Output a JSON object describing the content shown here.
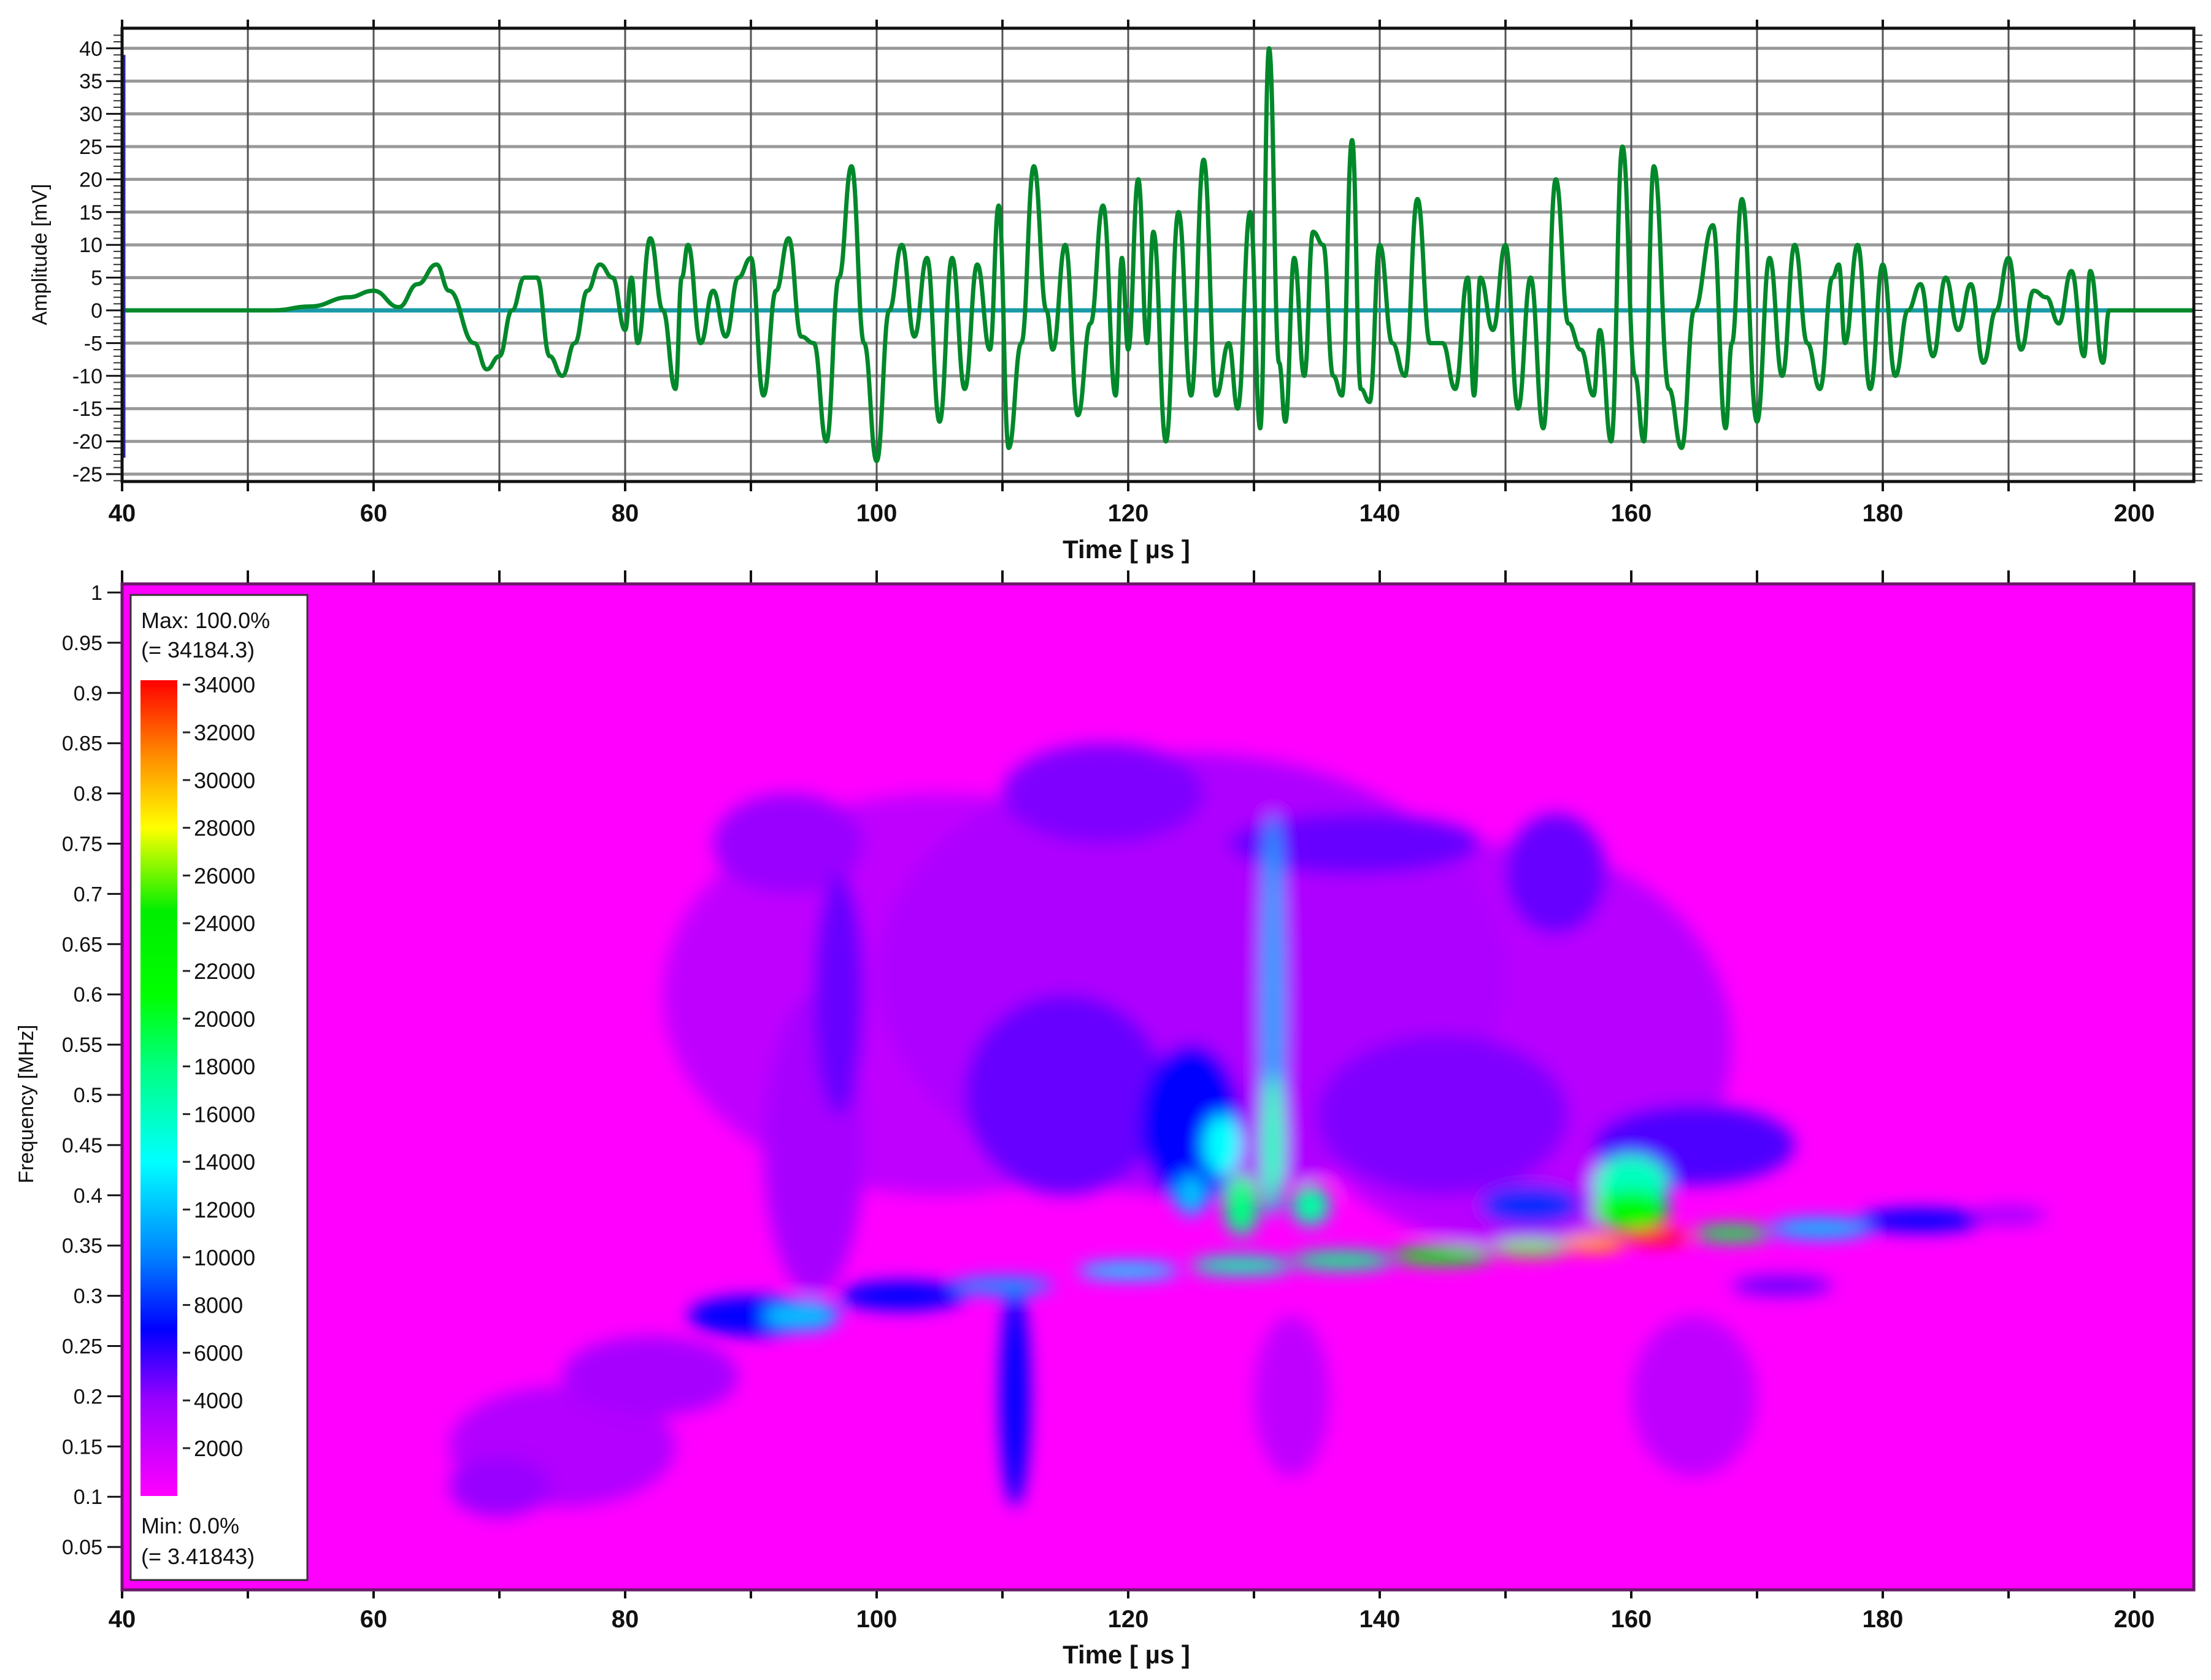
{
  "chart_data": [
    {
      "type": "line",
      "title": "",
      "xlabel": "Time  [ µs ]",
      "ylabel": "Amplitude [mV]",
      "xlim": [
        40,
        205
      ],
      "ylim": [
        -26.5,
        43
      ],
      "x_ticks": [
        "40",
        "60",
        "80",
        "100",
        "120",
        "140",
        "160",
        "180",
        "200"
      ],
      "y_ticks": [
        "40",
        "35",
        "30",
        "25",
        "20",
        "15",
        "10",
        "5",
        "0",
        "-5",
        "-10",
        "-15",
        "-20",
        "-25"
      ],
      "grid": true,
      "colors": {
        "signal": "#00882a",
        "baseline": "#1a9aa8",
        "marker": "#2a2a9a"
      },
      "marker_line": {
        "t": 40,
        "from": -22.5,
        "to": 39
      },
      "series": [
        {
          "name": "signal",
          "extrema": [
            [
              40,
              0
            ],
            [
              52,
              0
            ],
            [
              55,
              0.6
            ],
            [
              58,
              2
            ],
            [
              60,
              3
            ],
            [
              62,
              0.5
            ],
            [
              63.5,
              4
            ],
            [
              65,
              7
            ],
            [
              66,
              3
            ],
            [
              68,
              -5
            ],
            [
              69,
              -9
            ],
            [
              70,
              -7
            ],
            [
              71,
              0
            ],
            [
              72,
              5
            ],
            [
              73,
              5
            ],
            [
              74,
              -7
            ],
            [
              75,
              -10
            ],
            [
              76,
              -5
            ],
            [
              77,
              3
            ],
            [
              78,
              7
            ],
            [
              79,
              5
            ],
            [
              80,
              -3
            ],
            [
              80.5,
              5
            ],
            [
              81,
              -5
            ],
            [
              82,
              11
            ],
            [
              83,
              0
            ],
            [
              84,
              -12
            ],
            [
              84.5,
              5
            ],
            [
              85,
              10
            ],
            [
              86,
              -5
            ],
            [
              87,
              3
            ],
            [
              88,
              -4
            ],
            [
              89,
              5
            ],
            [
              90,
              8
            ],
            [
              91,
              -13
            ],
            [
              92,
              3
            ],
            [
              93,
              11
            ],
            [
              94,
              -4
            ],
            [
              95,
              -5
            ],
            [
              96,
              -20
            ],
            [
              97,
              5
            ],
            [
              98,
              22
            ],
            [
              99,
              -5
            ],
            [
              100,
              -23
            ],
            [
              101,
              0
            ],
            [
              102,
              10
            ],
            [
              103,
              -4
            ],
            [
              104,
              8
            ],
            [
              105,
              -17
            ],
            [
              106,
              8
            ],
            [
              107,
              -12
            ],
            [
              108,
              7
            ],
            [
              109,
              -6
            ],
            [
              109.7,
              16
            ],
            [
              110.5,
              -21
            ],
            [
              111.5,
              -5
            ],
            [
              112.5,
              22
            ],
            [
              113.5,
              0
            ],
            [
              114,
              -6
            ],
            [
              115,
              10
            ],
            [
              116,
              -16
            ],
            [
              117,
              -2
            ],
            [
              118,
              16
            ],
            [
              119,
              -13
            ],
            [
              119.5,
              8
            ],
            [
              120,
              -6
            ],
            [
              120.8,
              20
            ],
            [
              121.5,
              -5
            ],
            [
              122,
              12
            ],
            [
              123,
              -20
            ],
            [
              124,
              15
            ],
            [
              125,
              -13
            ],
            [
              126,
              23
            ],
            [
              127,
              -13
            ],
            [
              128,
              -5
            ],
            [
              128.7,
              -15
            ],
            [
              129.7,
              15
            ],
            [
              130.5,
              -18
            ],
            [
              131.2,
              40
            ],
            [
              132,
              -8
            ],
            [
              132.5,
              -17
            ],
            [
              133.2,
              8
            ],
            [
              134,
              -10
            ],
            [
              134.7,
              12
            ],
            [
              135.5,
              10
            ],
            [
              136.3,
              -10
            ],
            [
              137,
              -13
            ],
            [
              137.8,
              26
            ],
            [
              138.5,
              -12
            ],
            [
              139.2,
              -14
            ],
            [
              140,
              10
            ],
            [
              141,
              -5
            ],
            [
              142,
              -10
            ],
            [
              143,
              17
            ],
            [
              144,
              -5
            ],
            [
              145,
              -5
            ],
            [
              146,
              -12
            ],
            [
              147,
              5
            ],
            [
              147.5,
              -13
            ],
            [
              148,
              5
            ],
            [
              149,
              -3
            ],
            [
              150,
              10
            ],
            [
              151,
              -15
            ],
            [
              152,
              5
            ],
            [
              153,
              -18
            ],
            [
              154,
              20
            ],
            [
              155,
              -2
            ],
            [
              156,
              -6
            ],
            [
              157,
              -13
            ],
            [
              157.5,
              -3
            ],
            [
              158.4,
              -20
            ],
            [
              159.3,
              25
            ],
            [
              160.3,
              -10
            ],
            [
              161,
              -20
            ],
            [
              161.8,
              22
            ],
            [
              163,
              -12
            ],
            [
              164,
              -21
            ],
            [
              165,
              0
            ],
            [
              166.5,
              13
            ],
            [
              167.5,
              -18
            ],
            [
              168,
              -5
            ],
            [
              168.8,
              17
            ],
            [
              170,
              -17
            ],
            [
              171,
              8
            ],
            [
              172,
              -10
            ],
            [
              173,
              10
            ],
            [
              174,
              -5
            ],
            [
              175,
              -12
            ],
            [
              176,
              5
            ],
            [
              176.5,
              7
            ],
            [
              177,
              -5
            ],
            [
              178,
              10
            ],
            [
              179,
              -12
            ],
            [
              180,
              7
            ],
            [
              181,
              -10
            ],
            [
              182,
              0
            ],
            [
              183,
              4
            ],
            [
              184,
              -7
            ],
            [
              185,
              5
            ],
            [
              186,
              -3
            ],
            [
              187,
              4
            ],
            [
              188,
              -8
            ],
            [
              189,
              0
            ],
            [
              190,
              8
            ],
            [
              191,
              -6
            ],
            [
              192,
              3
            ],
            [
              193,
              2
            ],
            [
              194,
              -2
            ],
            [
              195,
              6
            ],
            [
              196,
              -7
            ],
            [
              196.5,
              6
            ],
            [
              197.5,
              -8
            ],
            [
              198,
              0
            ],
            [
              205,
              0
            ]
          ]
        }
      ]
    },
    {
      "type": "heatmap",
      "title": "",
      "xlabel": "Time  [ µs ]",
      "ylabel": "Frequency [MHz]",
      "xlim": [
        40,
        205
      ],
      "ylim": [
        0.007,
        1.01
      ],
      "x_ticks": [
        "40",
        "60",
        "80",
        "100",
        "120",
        "140",
        "160",
        "180",
        "200"
      ],
      "y_ticks": [
        "1",
        "0.95",
        "0.9",
        "0.85",
        "0.8",
        "0.75",
        "0.7",
        "0.65",
        "0.6",
        "0.55",
        "0.5",
        "0.45",
        "0.4",
        "0.35",
        "0.3",
        "0.25",
        "0.2",
        "0.15",
        "0.1",
        "0.05"
      ],
      "colorbar": {
        "max_label": "Max: 100.0%",
        "max_value_label": "(= 34184.3)",
        "min_label": "Min: 0.0%",
        "min_value_label": "(= 3.41843)",
        "ticks": [
          "34000",
          "32000",
          "30000",
          "28000",
          "26000",
          "24000",
          "22000",
          "20000",
          "18000",
          "16000",
          "14000",
          "12000",
          "10000",
          "8000",
          "6000",
          "4000",
          "2000"
        ],
        "range": [
          3.41843,
          34184.3
        ],
        "stops": [
          [
            0,
            "#ff00ff"
          ],
          [
            4000,
            "#9a00ff"
          ],
          [
            7000,
            "#0000ff"
          ],
          [
            10000,
            "#0080ff"
          ],
          [
            14000,
            "#00ffff"
          ],
          [
            18000,
            "#00ff80"
          ],
          [
            21000,
            "#00ff00"
          ],
          [
            24500,
            "#00ee00"
          ],
          [
            28000,
            "#ffff00"
          ],
          [
            31000,
            "#ff8c00"
          ],
          [
            34184,
            "#ff0000"
          ]
        ]
      },
      "hotspots": [
        {
          "t": 75,
          "f": 0.15,
          "dt": 9,
          "df": 0.06,
          "value": 3000
        },
        {
          "t": 70,
          "f": 0.11,
          "dt": 4,
          "df": 0.03,
          "value": 4000
        },
        {
          "t": 82,
          "f": 0.22,
          "dt": 7,
          "df": 0.04,
          "value": 3500
        },
        {
          "t": 105,
          "f": 0.6,
          "dt": 22,
          "df": 0.2,
          "value": 2500
        },
        {
          "t": 125,
          "f": 0.62,
          "dt": 25,
          "df": 0.22,
          "value": 3200
        },
        {
          "t": 150,
          "f": 0.55,
          "dt": 18,
          "df": 0.2,
          "value": 2800
        },
        {
          "t": 95,
          "f": 0.45,
          "dt": 4,
          "df": 0.15,
          "value": 3500
        },
        {
          "t": 97,
          "f": 0.6,
          "dt": 2,
          "df": 0.12,
          "value": 5000
        },
        {
          "t": 93,
          "f": 0.75,
          "dt": 6,
          "df": 0.05,
          "value": 4000
        },
        {
          "t": 118,
          "f": 0.8,
          "dt": 8,
          "df": 0.05,
          "value": 4500
        },
        {
          "t": 138,
          "f": 0.75,
          "dt": 10,
          "df": 0.03,
          "value": 5000
        },
        {
          "t": 154,
          "f": 0.72,
          "dt": 4,
          "df": 0.06,
          "value": 5000
        },
        {
          "t": 115,
          "f": 0.5,
          "dt": 8,
          "df": 0.1,
          "value": 5000
        },
        {
          "t": 125,
          "f": 0.47,
          "dt": 4,
          "df": 0.08,
          "value": 7000
        },
        {
          "t": 145,
          "f": 0.48,
          "dt": 10,
          "df": 0.08,
          "value": 4500
        },
        {
          "t": 165,
          "f": 0.45,
          "dt": 8,
          "df": 0.04,
          "value": 5500
        },
        {
          "t": 111,
          "f": 0.2,
          "dt": 1.2,
          "df": 0.11,
          "value": 7000
        },
        {
          "t": 131.5,
          "f": 0.58,
          "dt": 0.9,
          "df": 0.2,
          "value": 11000
        },
        {
          "t": 131.5,
          "f": 0.72,
          "dt": 0.8,
          "df": 0.06,
          "value": 7000
        },
        {
          "t": 131.5,
          "f": 0.45,
          "dt": 0.9,
          "df": 0.07,
          "value": 16000
        },
        {
          "t": 127.5,
          "f": 0.45,
          "dt": 1.5,
          "df": 0.03,
          "value": 14000
        },
        {
          "t": 129,
          "f": 0.39,
          "dt": 1.4,
          "df": 0.03,
          "value": 18000
        },
        {
          "t": 134.5,
          "f": 0.39,
          "dt": 1.5,
          "df": 0.02,
          "value": 17000
        },
        {
          "t": 125,
          "f": 0.4,
          "dt": 1.2,
          "df": 0.02,
          "value": 12000
        },
        {
          "t": 160,
          "f": 0.41,
          "dt": 3,
          "df": 0.03,
          "value": 16000
        },
        {
          "t": 160,
          "f": 0.385,
          "dt": 3,
          "df": 0.02,
          "value": 22000
        },
        {
          "t": 152,
          "f": 0.39,
          "dt": 4,
          "df": 0.02,
          "value": 8000
        },
        {
          "t": 90,
          "f": 0.28,
          "dt": 5,
          "df": 0.02,
          "value": 7000
        },
        {
          "t": 94,
          "f": 0.28,
          "dt": 3,
          "df": 0.015,
          "value": 12000
        },
        {
          "t": 102,
          "f": 0.3,
          "dt": 5,
          "df": 0.015,
          "value": 7000
        },
        {
          "t": 110,
          "f": 0.31,
          "dt": 4,
          "df": 0.008,
          "value": 11000
        },
        {
          "t": 120,
          "f": 0.325,
          "dt": 4,
          "df": 0.008,
          "value": 13000
        },
        {
          "t": 129,
          "f": 0.33,
          "dt": 4,
          "df": 0.009,
          "value": 17000
        },
        {
          "t": 137,
          "f": 0.335,
          "dt": 4,
          "df": 0.009,
          "value": 18000
        },
        {
          "t": 145,
          "f": 0.34,
          "dt": 4,
          "df": 0.009,
          "value": 21000
        },
        {
          "t": 152,
          "f": 0.347,
          "dt": 3,
          "df": 0.008,
          "value": 26000
        },
        {
          "t": 157,
          "f": 0.352,
          "dt": 2.5,
          "df": 0.008,
          "value": 30000
        },
        {
          "t": 162,
          "f": 0.358,
          "dt": 2.5,
          "df": 0.007,
          "value": 34000
        },
        {
          "t": 168,
          "f": 0.362,
          "dt": 3,
          "df": 0.008,
          "value": 20000
        },
        {
          "t": 175,
          "f": 0.367,
          "dt": 4,
          "df": 0.01,
          "value": 12000
        },
        {
          "t": 183,
          "f": 0.375,
          "dt": 5,
          "df": 0.012,
          "value": 7000
        },
        {
          "t": 190,
          "f": 0.38,
          "dt": 3,
          "df": 0.01,
          "value": 3500
        },
        {
          "t": 172,
          "f": 0.31,
          "dt": 4,
          "df": 0.01,
          "value": 5000
        },
        {
          "t": 165,
          "f": 0.2,
          "dt": 5,
          "df": 0.08,
          "value": 2500
        },
        {
          "t": 133,
          "f": 0.2,
          "dt": 3,
          "df": 0.08,
          "value": 2500
        }
      ]
    }
  ]
}
